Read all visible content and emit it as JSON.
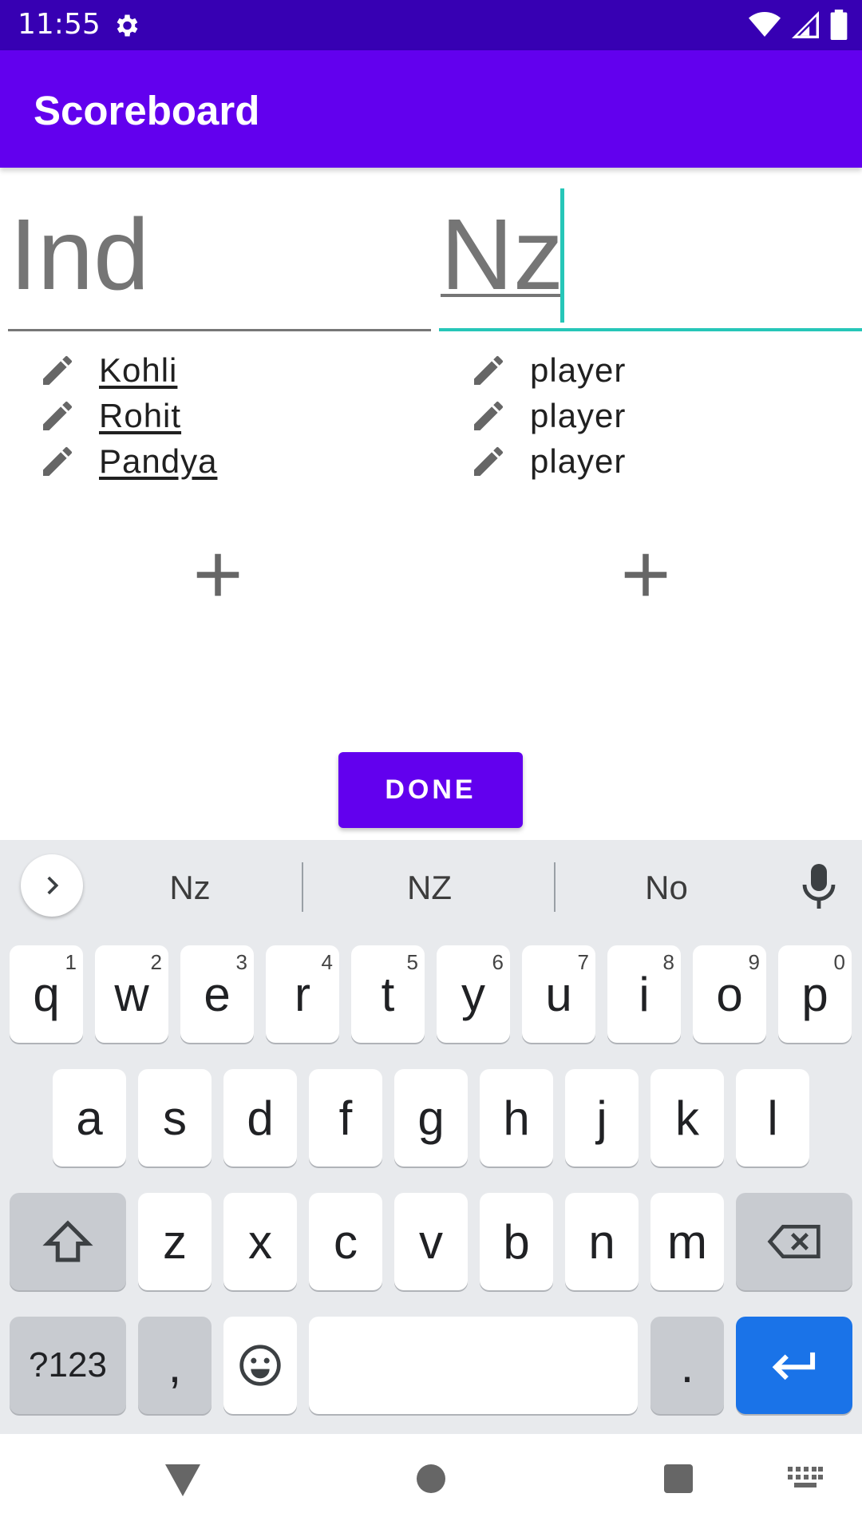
{
  "status_bar": {
    "time": "11:55"
  },
  "app_bar": {
    "title": "Scoreboard"
  },
  "teams": [
    {
      "name": "Ind",
      "players": [
        "Kohli",
        "Rohit",
        "Pandya"
      ]
    },
    {
      "name": "Nz",
      "players": [
        "player",
        "player",
        "player"
      ]
    }
  ],
  "done_label": "DONE",
  "keyboard": {
    "suggestions": [
      "Nz",
      "NZ",
      "No"
    ],
    "row1": [
      {
        "k": "q",
        "h": "1"
      },
      {
        "k": "w",
        "h": "2"
      },
      {
        "k": "e",
        "h": "3"
      },
      {
        "k": "r",
        "h": "4"
      },
      {
        "k": "t",
        "h": "5"
      },
      {
        "k": "y",
        "h": "6"
      },
      {
        "k": "u",
        "h": "7"
      },
      {
        "k": "i",
        "h": "8"
      },
      {
        "k": "o",
        "h": "9"
      },
      {
        "k": "p",
        "h": "0"
      }
    ],
    "row2": [
      "a",
      "s",
      "d",
      "f",
      "g",
      "h",
      "j",
      "k",
      "l"
    ],
    "row3": [
      "z",
      "x",
      "c",
      "v",
      "b",
      "n",
      "m"
    ],
    "symbols_label": "?123",
    "comma_label": ",",
    "period_label": "."
  },
  "colors": {
    "status_bar": "#3700b3",
    "app_bar": "#6200ee",
    "accent_teal": "#26c6b8",
    "enter_key": "#1a73e8"
  }
}
